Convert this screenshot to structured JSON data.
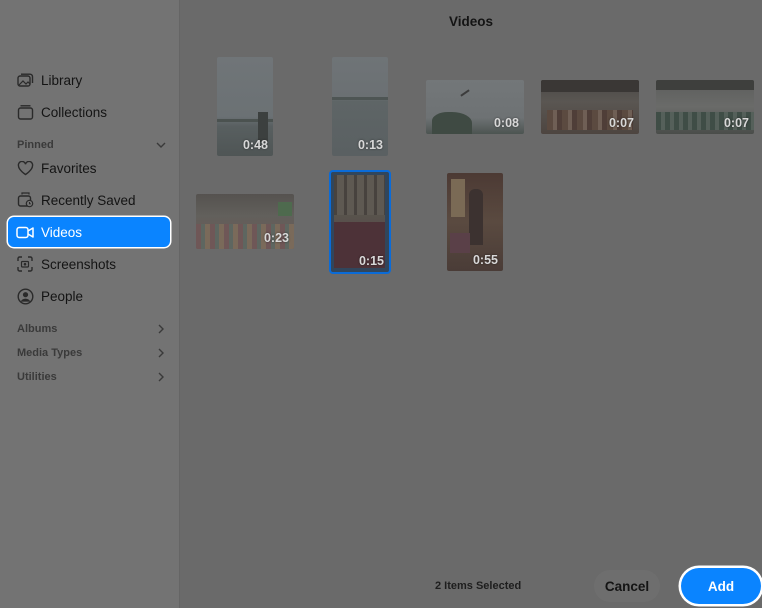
{
  "sidebar": {
    "items": [
      {
        "label": "Library",
        "icon": "photo-library-icon"
      },
      {
        "label": "Collections",
        "icon": "collections-icon"
      },
      {
        "label": "Favorites",
        "icon": "heart-icon"
      },
      {
        "label": "Recently Saved",
        "icon": "recently-saved-icon"
      },
      {
        "label": "Videos",
        "icon": "video-camera-icon",
        "selected": true
      },
      {
        "label": "Screenshots",
        "icon": "screenshot-icon"
      },
      {
        "label": "People",
        "icon": "person-icon"
      }
    ],
    "sections": {
      "pinned": "Pinned",
      "albums": "Albums",
      "media_types": "Media Types",
      "utilities": "Utilities"
    }
  },
  "main": {
    "title": "Videos",
    "videos": [
      {
        "duration": "0:48"
      },
      {
        "duration": "0:13"
      },
      {
        "duration": "0:08"
      },
      {
        "duration": "0:07"
      },
      {
        "duration": "0:07"
      },
      {
        "duration": "0:23"
      },
      {
        "duration": "0:15",
        "selected": true
      },
      {
        "duration": "0:55"
      }
    ]
  },
  "footer": {
    "status": "2 Items Selected",
    "cancel_label": "Cancel",
    "add_label": "Add"
  },
  "colors": {
    "accent": "#0a84ff",
    "dimmed_background": "#6a6a6a"
  }
}
